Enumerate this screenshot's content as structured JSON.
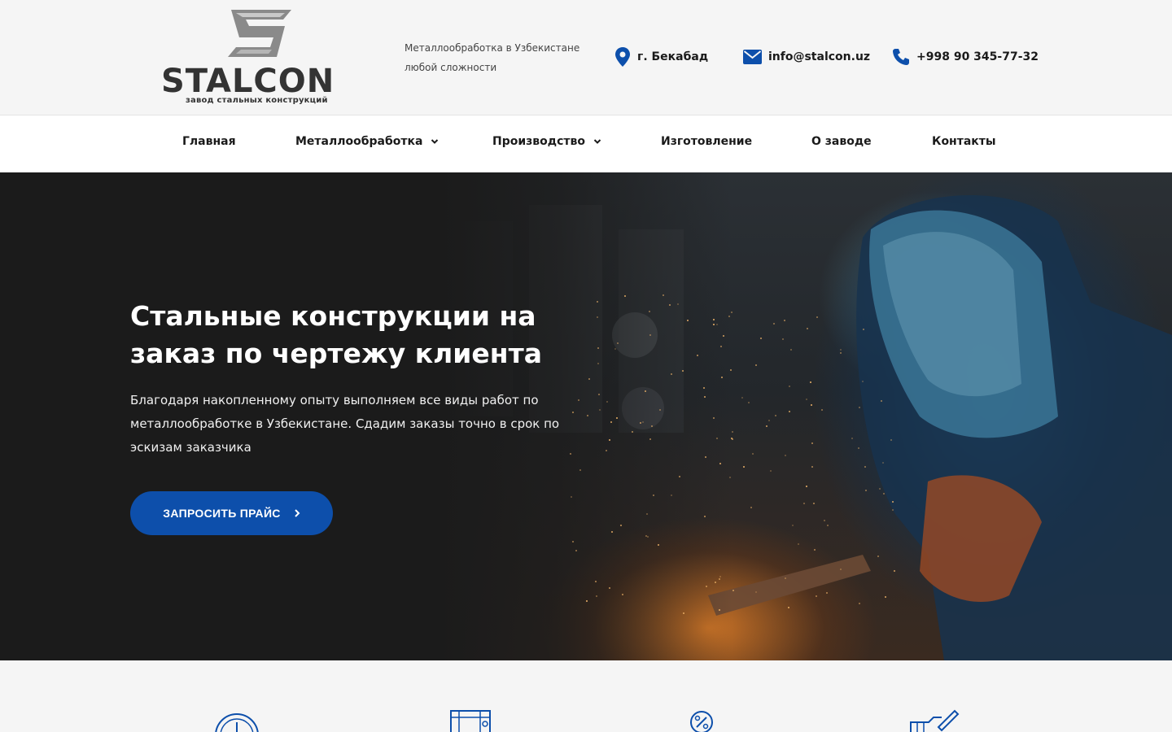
{
  "brand": {
    "name": "STALCON",
    "subtitle": "завод стальных конструкций"
  },
  "header": {
    "tagline": "Металлообработка в Узбекистане любой сложности",
    "city": "г. Бекабад",
    "email": "info@stalcon.uz",
    "phone": "+998 90 345-77-32",
    "accent": "#0d4fab"
  },
  "nav": {
    "items": [
      {
        "label": "Главная"
      },
      {
        "label": "Металлообработка"
      },
      {
        "label": "Производство"
      },
      {
        "label": "Изготовление"
      },
      {
        "label": "О заводе"
      },
      {
        "label": "Контакты"
      }
    ]
  },
  "hero": {
    "title": "Стальные конструкции на заказ по чертежу клиента",
    "text": "Благодаря накопленному опыту выполняем все виды работ по металлообработке в Узбекистане. Сдадим заказы точно в срок по эскизам заказчика",
    "cta_label": "ЗАПРОСИТЬ ПРАЙС"
  },
  "features": {
    "icons": [
      "clock-icon",
      "machine-icon",
      "percent-icon",
      "drawing-icon"
    ]
  }
}
